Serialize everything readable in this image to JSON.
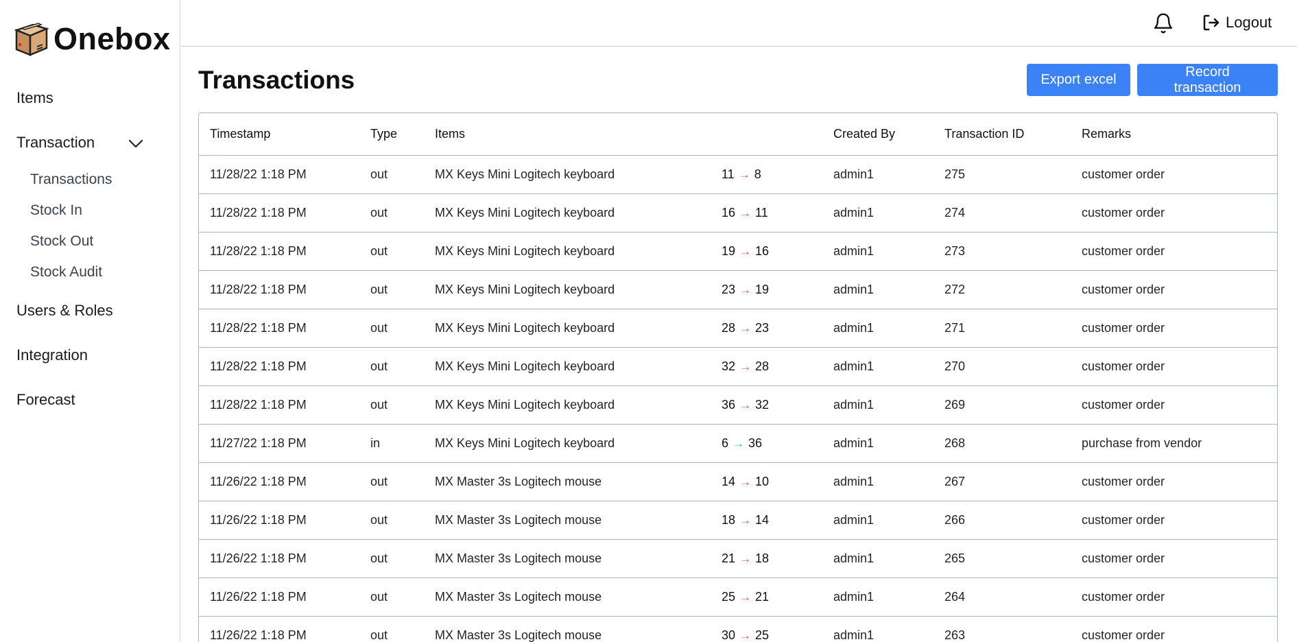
{
  "app": {
    "name": "Onebox"
  },
  "sidebar": {
    "items": [
      {
        "label": "Items"
      },
      {
        "label": "Transaction"
      },
      {
        "label": "Users & Roles"
      },
      {
        "label": "Integration"
      },
      {
        "label": "Forecast"
      }
    ],
    "transaction_sub": [
      {
        "label": "Transactions"
      },
      {
        "label": "Stock In"
      },
      {
        "label": "Stock Out"
      },
      {
        "label": "Stock Audit"
      }
    ]
  },
  "header": {
    "logout_label": "Logout"
  },
  "main": {
    "title": "Transactions",
    "export_label": "Export excel",
    "record_label": "Record transaction"
  },
  "colors": {
    "accent": "#3b82f6",
    "arrow_out": "#ef4444",
    "arrow_in": "#22c55e"
  },
  "table": {
    "columns": [
      "Timestamp",
      "Type",
      "Items",
      "",
      "Created By",
      "Transaction ID",
      "Remarks"
    ],
    "rows": [
      {
        "timestamp": "11/28/22 1:18 PM",
        "type": "out",
        "item": "MX Keys Mini Logitech keyboard",
        "from": "11",
        "to": "8",
        "created_by": "admin1",
        "id": "275",
        "remarks": "customer order"
      },
      {
        "timestamp": "11/28/22 1:18 PM",
        "type": "out",
        "item": "MX Keys Mini Logitech keyboard",
        "from": "16",
        "to": "11",
        "created_by": "admin1",
        "id": "274",
        "remarks": "customer order"
      },
      {
        "timestamp": "11/28/22 1:18 PM",
        "type": "out",
        "item": "MX Keys Mini Logitech keyboard",
        "from": "19",
        "to": "16",
        "created_by": "admin1",
        "id": "273",
        "remarks": "customer order"
      },
      {
        "timestamp": "11/28/22 1:18 PM",
        "type": "out",
        "item": "MX Keys Mini Logitech keyboard",
        "from": "23",
        "to": "19",
        "created_by": "admin1",
        "id": "272",
        "remarks": "customer order"
      },
      {
        "timestamp": "11/28/22 1:18 PM",
        "type": "out",
        "item": "MX Keys Mini Logitech keyboard",
        "from": "28",
        "to": "23",
        "created_by": "admin1",
        "id": "271",
        "remarks": "customer order"
      },
      {
        "timestamp": "11/28/22 1:18 PM",
        "type": "out",
        "item": "MX Keys Mini Logitech keyboard",
        "from": "32",
        "to": "28",
        "created_by": "admin1",
        "id": "270",
        "remarks": "customer order"
      },
      {
        "timestamp": "11/28/22 1:18 PM",
        "type": "out",
        "item": "MX Keys Mini Logitech keyboard",
        "from": "36",
        "to": "32",
        "created_by": "admin1",
        "id": "269",
        "remarks": "customer order"
      },
      {
        "timestamp": "11/27/22 1:18 PM",
        "type": "in",
        "item": "MX Keys Mini Logitech keyboard",
        "from": "6",
        "to": "36",
        "created_by": "admin1",
        "id": "268",
        "remarks": "purchase from vendor"
      },
      {
        "timestamp": "11/26/22 1:18 PM",
        "type": "out",
        "item": "MX Master 3s Logitech mouse",
        "from": "14",
        "to": "10",
        "created_by": "admin1",
        "id": "267",
        "remarks": "customer order"
      },
      {
        "timestamp": "11/26/22 1:18 PM",
        "type": "out",
        "item": "MX Master 3s Logitech mouse",
        "from": "18",
        "to": "14",
        "created_by": "admin1",
        "id": "266",
        "remarks": "customer order"
      },
      {
        "timestamp": "11/26/22 1:18 PM",
        "type": "out",
        "item": "MX Master 3s Logitech mouse",
        "from": "21",
        "to": "18",
        "created_by": "admin1",
        "id": "265",
        "remarks": "customer order"
      },
      {
        "timestamp": "11/26/22 1:18 PM",
        "type": "out",
        "item": "MX Master 3s Logitech mouse",
        "from": "25",
        "to": "21",
        "created_by": "admin1",
        "id": "264",
        "remarks": "customer order"
      },
      {
        "timestamp": "11/26/22 1:18 PM",
        "type": "out",
        "item": "MX Master 3s Logitech mouse",
        "from": "30",
        "to": "25",
        "created_by": "admin1",
        "id": "263",
        "remarks": "customer order"
      }
    ]
  }
}
